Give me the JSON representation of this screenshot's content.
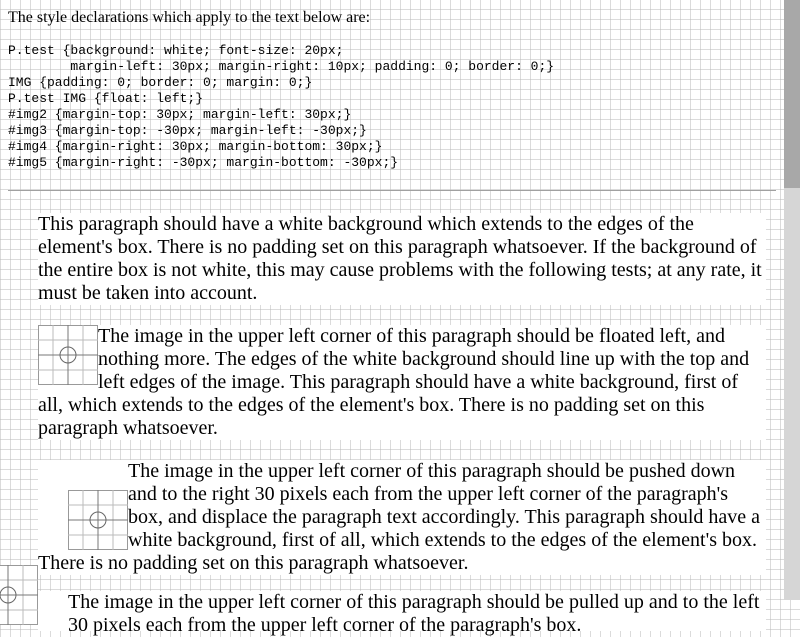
{
  "intro": "The style declarations which apply to the text below are:",
  "css_rules": "P.test {background: white; font-size: 20px;\n        margin-left: 30px; margin-right: 10px; padding: 0; border: 0;}\nIMG {padding: 0; border: 0; margin: 0;}\nP.test IMG {float: left;}\n#img2 {margin-top: 30px; margin-left: 30px;}\n#img3 {margin-top: -30px; margin-left: -30px;}\n#img4 {margin-right: 30px; margin-bottom: 30px;}\n#img5 {margin-right: -30px; margin-bottom: -30px;}",
  "paragraphs": [
    "This paragraph should have a white background which extends to the edges of the element's box. There is no padding set on this paragraph whatsoever. If the background of the entire box is not white, this may cause problems with the following tests; at any rate, it must be taken into account.",
    "The image in the upper left corner of this paragraph should be floated left, and nothing more. The edges of the white background should line up with the top and left edges of the image. This paragraph should have a white background, first of all, which extends to the edges of the element's box. There is no padding set on this paragraph whatsoever.",
    "The image in the upper left corner of this paragraph should be pushed down and to the right 30 pixels each from the upper left corner of the paragraph's box, and displace the paragraph text accordingly. This paragraph should have a white background, first of all, which extends to the edges of the element's box. There is no padding set on this paragraph whatsoever.",
    "The image in the upper left corner of this paragraph should be pulled up and to the left 30 pixels each from the upper left corner of the paragraph's box."
  ],
  "icons": {
    "test_image": "crosshair-target-icon"
  },
  "colors": {
    "paragraph_background": "#ffffff",
    "grid_line": "#bebebe"
  }
}
